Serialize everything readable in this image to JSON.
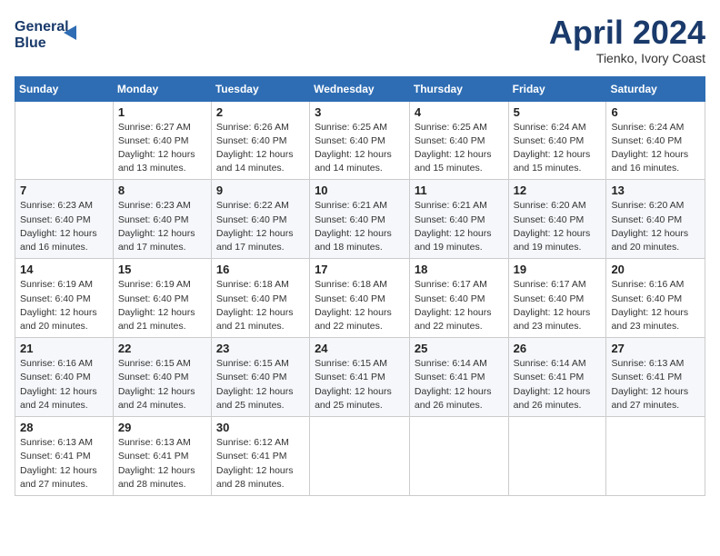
{
  "header": {
    "logo_line1": "General",
    "logo_line2": "Blue",
    "month": "April 2024",
    "location": "Tienko, Ivory Coast"
  },
  "weekdays": [
    "Sunday",
    "Monday",
    "Tuesday",
    "Wednesday",
    "Thursday",
    "Friday",
    "Saturday"
  ],
  "weeks": [
    [
      {
        "day": "",
        "info": ""
      },
      {
        "day": "1",
        "info": "Sunrise: 6:27 AM\nSunset: 6:40 PM\nDaylight: 12 hours\nand 13 minutes."
      },
      {
        "day": "2",
        "info": "Sunrise: 6:26 AM\nSunset: 6:40 PM\nDaylight: 12 hours\nand 14 minutes."
      },
      {
        "day": "3",
        "info": "Sunrise: 6:25 AM\nSunset: 6:40 PM\nDaylight: 12 hours\nand 14 minutes."
      },
      {
        "day": "4",
        "info": "Sunrise: 6:25 AM\nSunset: 6:40 PM\nDaylight: 12 hours\nand 15 minutes."
      },
      {
        "day": "5",
        "info": "Sunrise: 6:24 AM\nSunset: 6:40 PM\nDaylight: 12 hours\nand 15 minutes."
      },
      {
        "day": "6",
        "info": "Sunrise: 6:24 AM\nSunset: 6:40 PM\nDaylight: 12 hours\nand 16 minutes."
      }
    ],
    [
      {
        "day": "7",
        "info": "Sunrise: 6:23 AM\nSunset: 6:40 PM\nDaylight: 12 hours\nand 16 minutes."
      },
      {
        "day": "8",
        "info": "Sunrise: 6:23 AM\nSunset: 6:40 PM\nDaylight: 12 hours\nand 17 minutes."
      },
      {
        "day": "9",
        "info": "Sunrise: 6:22 AM\nSunset: 6:40 PM\nDaylight: 12 hours\nand 17 minutes."
      },
      {
        "day": "10",
        "info": "Sunrise: 6:21 AM\nSunset: 6:40 PM\nDaylight: 12 hours\nand 18 minutes."
      },
      {
        "day": "11",
        "info": "Sunrise: 6:21 AM\nSunset: 6:40 PM\nDaylight: 12 hours\nand 19 minutes."
      },
      {
        "day": "12",
        "info": "Sunrise: 6:20 AM\nSunset: 6:40 PM\nDaylight: 12 hours\nand 19 minutes."
      },
      {
        "day": "13",
        "info": "Sunrise: 6:20 AM\nSunset: 6:40 PM\nDaylight: 12 hours\nand 20 minutes."
      }
    ],
    [
      {
        "day": "14",
        "info": "Sunrise: 6:19 AM\nSunset: 6:40 PM\nDaylight: 12 hours\nand 20 minutes."
      },
      {
        "day": "15",
        "info": "Sunrise: 6:19 AM\nSunset: 6:40 PM\nDaylight: 12 hours\nand 21 minutes."
      },
      {
        "day": "16",
        "info": "Sunrise: 6:18 AM\nSunset: 6:40 PM\nDaylight: 12 hours\nand 21 minutes."
      },
      {
        "day": "17",
        "info": "Sunrise: 6:18 AM\nSunset: 6:40 PM\nDaylight: 12 hours\nand 22 minutes."
      },
      {
        "day": "18",
        "info": "Sunrise: 6:17 AM\nSunset: 6:40 PM\nDaylight: 12 hours\nand 22 minutes."
      },
      {
        "day": "19",
        "info": "Sunrise: 6:17 AM\nSunset: 6:40 PM\nDaylight: 12 hours\nand 23 minutes."
      },
      {
        "day": "20",
        "info": "Sunrise: 6:16 AM\nSunset: 6:40 PM\nDaylight: 12 hours\nand 23 minutes."
      }
    ],
    [
      {
        "day": "21",
        "info": "Sunrise: 6:16 AM\nSunset: 6:40 PM\nDaylight: 12 hours\nand 24 minutes."
      },
      {
        "day": "22",
        "info": "Sunrise: 6:15 AM\nSunset: 6:40 PM\nDaylight: 12 hours\nand 24 minutes."
      },
      {
        "day": "23",
        "info": "Sunrise: 6:15 AM\nSunset: 6:40 PM\nDaylight: 12 hours\nand 25 minutes."
      },
      {
        "day": "24",
        "info": "Sunrise: 6:15 AM\nSunset: 6:41 PM\nDaylight: 12 hours\nand 25 minutes."
      },
      {
        "day": "25",
        "info": "Sunrise: 6:14 AM\nSunset: 6:41 PM\nDaylight: 12 hours\nand 26 minutes."
      },
      {
        "day": "26",
        "info": "Sunrise: 6:14 AM\nSunset: 6:41 PM\nDaylight: 12 hours\nand 26 minutes."
      },
      {
        "day": "27",
        "info": "Sunrise: 6:13 AM\nSunset: 6:41 PM\nDaylight: 12 hours\nand 27 minutes."
      }
    ],
    [
      {
        "day": "28",
        "info": "Sunrise: 6:13 AM\nSunset: 6:41 PM\nDaylight: 12 hours\nand 27 minutes."
      },
      {
        "day": "29",
        "info": "Sunrise: 6:13 AM\nSunset: 6:41 PM\nDaylight: 12 hours\nand 28 minutes."
      },
      {
        "day": "30",
        "info": "Sunrise: 6:12 AM\nSunset: 6:41 PM\nDaylight: 12 hours\nand 28 minutes."
      },
      {
        "day": "",
        "info": ""
      },
      {
        "day": "",
        "info": ""
      },
      {
        "day": "",
        "info": ""
      },
      {
        "day": "",
        "info": ""
      }
    ]
  ]
}
